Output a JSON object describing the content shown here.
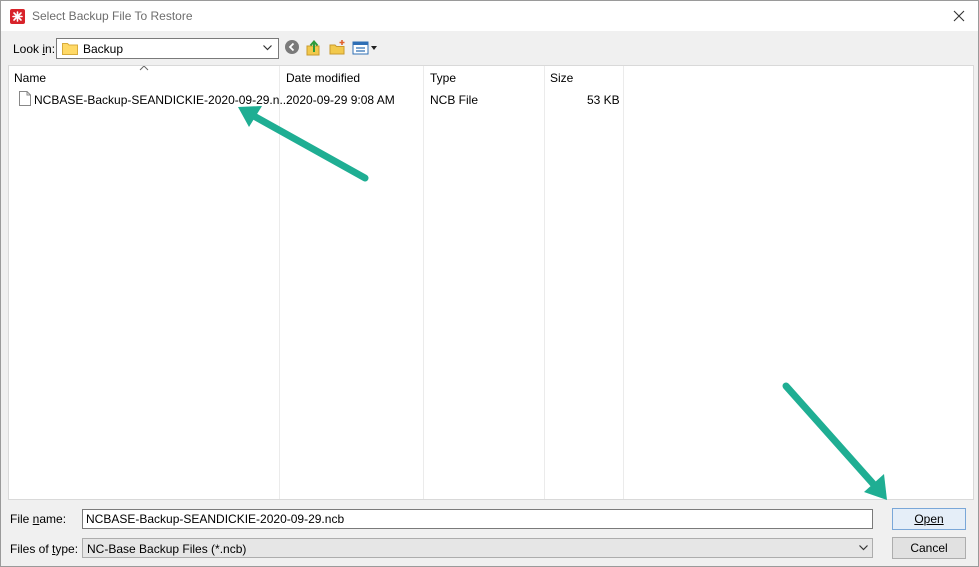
{
  "window": {
    "title": "Select Backup File To Restore",
    "accent_color": "#d8232a"
  },
  "toolbar": {
    "look_in_label_pre": "Look ",
    "look_in_label_key": "i",
    "look_in_label_post": "n:",
    "look_in_value": "Backup",
    "icons": [
      "back-icon",
      "up-folder-icon",
      "new-folder-icon",
      "view-menu-icon"
    ]
  },
  "file_list": {
    "columns": [
      "Name",
      "Date modified",
      "Type",
      "Size"
    ],
    "rows": [
      {
        "name": "NCBASE-Backup-SEANDICKIE-2020-09-29.n...",
        "date": "2020-09-29 9:08 AM",
        "type": "NCB File",
        "size": "53 KB"
      }
    ]
  },
  "bottom": {
    "file_name_label_pre": "File ",
    "file_name_label_key": "n",
    "file_name_label_post": "ame:",
    "file_name_value": "NCBASE-Backup-SEANDICKIE-2020-09-29.ncb",
    "file_type_label_pre": "Files of ",
    "file_type_label_key": "t",
    "file_type_label_post": "ype:",
    "file_type_value": "NC-Base Backup Files (*.ncb)",
    "open_label": "Open",
    "cancel_label": "Cancel"
  },
  "annotation": {
    "arrow_color": "#1fae93"
  }
}
